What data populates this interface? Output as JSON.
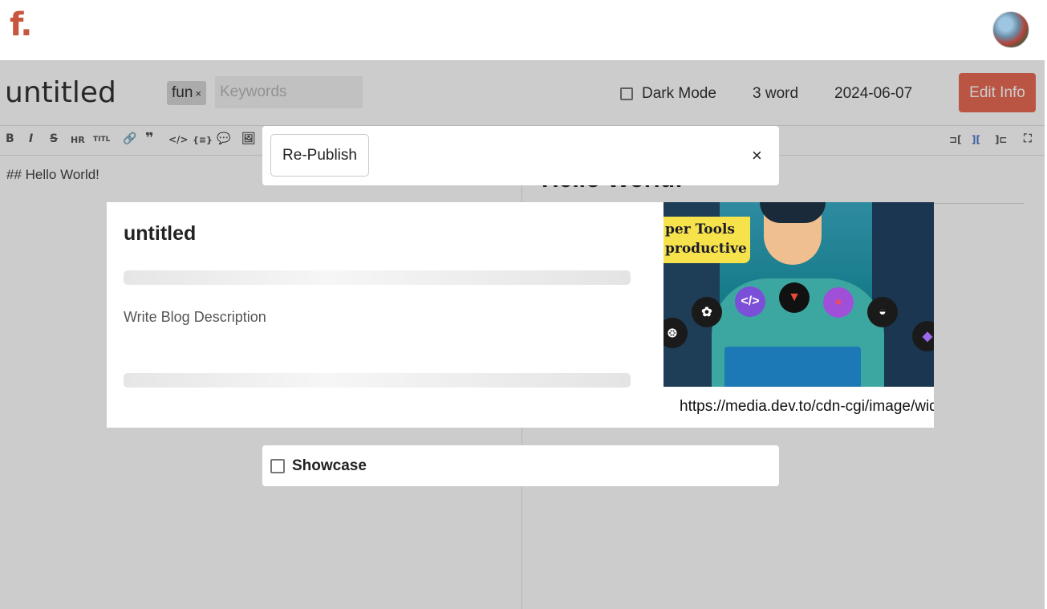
{
  "app": {
    "logo": "f.",
    "avatar_alt": "avatar"
  },
  "editor": {
    "title": "untitled",
    "tags": [
      {
        "label": "fun",
        "remove": "×"
      }
    ],
    "keywords_placeholder": "Keywords",
    "dark_mode_label": "Dark Mode",
    "word_count": "3 word",
    "date": "2024-06-07",
    "edit_info_label": "Edit Info",
    "markdown_source": "## Hello World!",
    "preview_heading": "Hello World!"
  },
  "toolbar": {
    "bold": "B",
    "italic": "I",
    "strike": "S",
    "hr": "HR",
    "title": "TITL",
    "link": "🔗",
    "quote": "❞",
    "code": "</>",
    "codeblock": "{≡}",
    "comment": "💬",
    "image": "🖼",
    "layout_left": "⊐[",
    "layout_split": "][",
    "layout_right": "]⊏",
    "fullscreen": "⛶"
  },
  "publish": {
    "republish_label": "Re-Publish",
    "close_icon": "×"
  },
  "card": {
    "title": "untitled",
    "description_placeholder": "Write Blog Description",
    "cover_text_line1": "per Tools",
    "cover_text_line2": "productive",
    "cover_url": "https://media.dev.to/cdn-cgi/image/width=1000,height=420,fit=cover"
  },
  "showcase": {
    "label": "Showcase"
  },
  "colors": {
    "accent": "#e96b55",
    "logo": "#c8553d",
    "overlay": "rgba(0,0,0,0.2)"
  }
}
